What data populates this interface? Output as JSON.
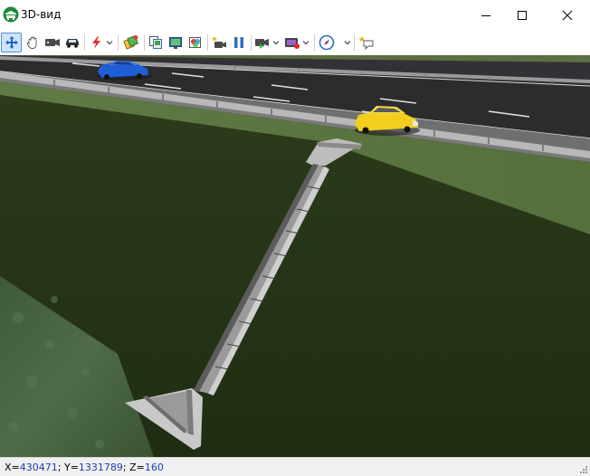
{
  "window": {
    "title": "3D-вид"
  },
  "toolbar": {
    "tools": [
      {
        "name": "pan-move-icon",
        "active": true
      },
      {
        "name": "hand-icon"
      },
      {
        "name": "camera-icon"
      },
      {
        "name": "car-icon"
      },
      {
        "name": "lightning-icon",
        "dropdown": true
      },
      {
        "name": "layers-paint-icon"
      },
      {
        "name": "copy-view-icon"
      },
      {
        "name": "screenshot-icon"
      },
      {
        "name": "color-palette-icon"
      },
      {
        "name": "add-camera-icon"
      },
      {
        "name": "pause-icon"
      },
      {
        "name": "video-camera-icon",
        "dropdown": true
      },
      {
        "name": "record-icon",
        "dropdown": true
      },
      {
        "name": "compass-icon",
        "dropdown": true
      },
      {
        "name": "light-note-icon"
      }
    ]
  },
  "status": {
    "x_label": "X=",
    "x_value": "430471",
    "y_label": "; Y=",
    "y_value": "1331789",
    "z_label": "; Z=",
    "z_value": "160"
  },
  "colors": {
    "accent": "#4a8fd6",
    "coord_value": "#1f3fb3",
    "grass_dark": "#243315",
    "road": "#2a2a2c",
    "car_blue": "#1f5fd6",
    "car_yellow": "#f2cf1d"
  }
}
